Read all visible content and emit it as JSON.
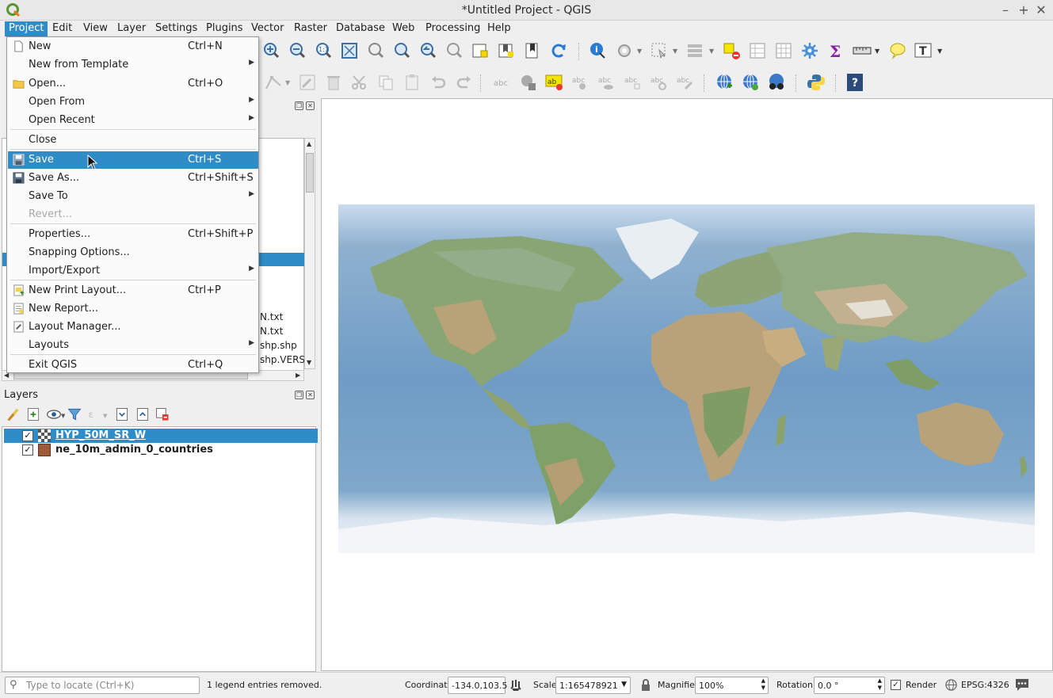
{
  "window": {
    "title": "*Untitled Project - QGIS"
  },
  "menubar": [
    {
      "label": "Project"
    },
    {
      "label": "Edit"
    },
    {
      "label": "View"
    },
    {
      "label": "Layer"
    },
    {
      "label": "Settings"
    },
    {
      "label": "Plugins"
    },
    {
      "label": "Vector"
    },
    {
      "label": "Raster"
    },
    {
      "label": "Database"
    },
    {
      "label": "Web"
    },
    {
      "label": "Processing"
    },
    {
      "label": "Help"
    }
  ],
  "project_menu": {
    "items": [
      {
        "label": "New",
        "shortcut": "Ctrl+N"
      },
      {
        "label": "New from Template",
        "shortcut": ""
      },
      {
        "label": "Open...",
        "shortcut": "Ctrl+O"
      },
      {
        "label": "Open From",
        "shortcut": ""
      },
      {
        "label": "Open Recent",
        "shortcut": ""
      },
      {
        "label": "Close",
        "shortcut": ""
      },
      {
        "label": "Save",
        "shortcut": "Ctrl+S"
      },
      {
        "label": "Save As...",
        "shortcut": "Ctrl+Shift+S"
      },
      {
        "label": "Save To",
        "shortcut": ""
      },
      {
        "label": "Revert...",
        "shortcut": ""
      },
      {
        "label": "Properties...",
        "shortcut": "Ctrl+Shift+P"
      },
      {
        "label": "Snapping Options...",
        "shortcut": ""
      },
      {
        "label": "Import/Export",
        "shortcut": ""
      },
      {
        "label": "New Print Layout...",
        "shortcut": "Ctrl+P"
      },
      {
        "label": "New Report...",
        "shortcut": ""
      },
      {
        "label": "Layout Manager...",
        "shortcut": ""
      },
      {
        "label": "Layouts",
        "shortcut": ""
      },
      {
        "label": "Exit QGIS",
        "shortcut": "Ctrl+Q"
      }
    ]
  },
  "browser_panel": {
    "files": [
      "N.txt",
      "N.txt",
      "shp.shp",
      "shp.VERSI"
    ]
  },
  "layers_panel": {
    "title": "Layers",
    "layers": [
      {
        "name": "HYP_50M_SR_W",
        "checked": "✓"
      },
      {
        "name": "ne_10m_admin_0_countries",
        "checked": "✓"
      }
    ]
  },
  "statusbar": {
    "locate_placeholder": "Type to locate (Ctrl+K)",
    "message": "1 legend entries removed.",
    "coordinate_label": "Coordinate",
    "coordinate_value": "-134.0,103.5",
    "scale_label": "Scale",
    "scale_value": "1:165478921",
    "magnifier_label": "Magnifier",
    "magnifier_value": "100%",
    "rotation_label": "Rotation",
    "rotation_value": "0.0 °",
    "render_label": "Render",
    "crs": "EPSG:4326"
  }
}
